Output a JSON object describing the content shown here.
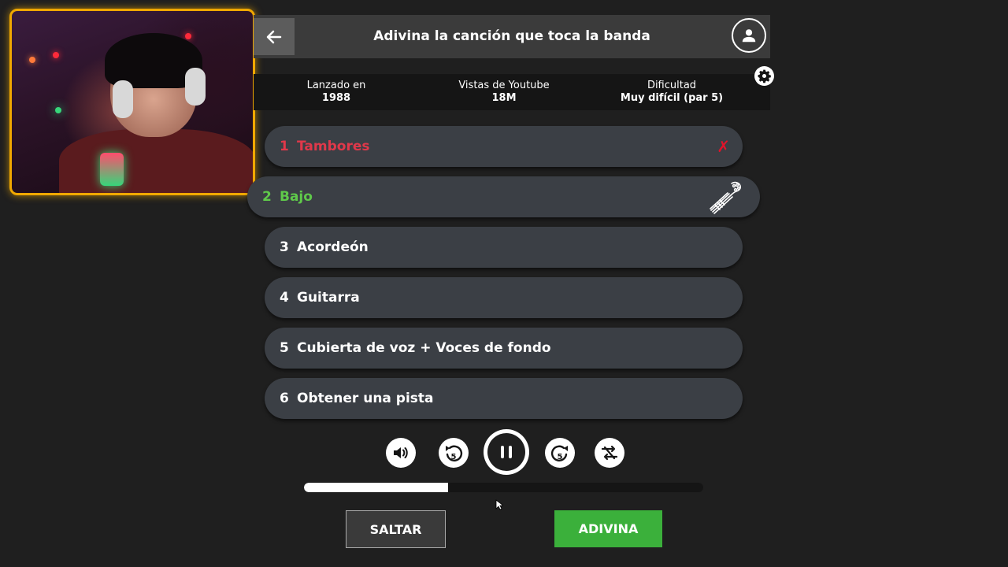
{
  "header": {
    "title": "Adivina la canción que toca la banda",
    "back_icon": "arrow-left-icon",
    "user_icon": "user-icon"
  },
  "info": {
    "released_label": "Lanzado en",
    "released_value": "1988",
    "views_label": "Vistas de Youtube",
    "views_value": "18M",
    "difficulty_label": "Dificultad",
    "difficulty_value": "Muy difícil (par 5)"
  },
  "tracks": [
    {
      "num": "1",
      "label": "Tambores",
      "state": "failed"
    },
    {
      "num": "2",
      "label": "Bajo",
      "state": "active"
    },
    {
      "num": "3",
      "label": "Acordeón",
      "state": "locked"
    },
    {
      "num": "4",
      "label": "Guitarra",
      "state": "locked"
    },
    {
      "num": "5",
      "label": "Cubierta de voz + Voces de fondo",
      "state": "locked"
    },
    {
      "num": "6",
      "label": "Obtener una pista",
      "state": "locked"
    }
  ],
  "player": {
    "controls": [
      "volume-icon",
      "rewind-5-icon",
      "pause-icon",
      "forward-5-icon",
      "shuffle-icon"
    ],
    "progress": 0.36
  },
  "actions": {
    "skip_label": "SALTAR",
    "guess_label": "ADIVINA"
  },
  "colors": {
    "failed": "#e0384a",
    "active": "#5fc94a",
    "guess_button": "#3bb03b",
    "webcam_border": "#f0a800"
  }
}
